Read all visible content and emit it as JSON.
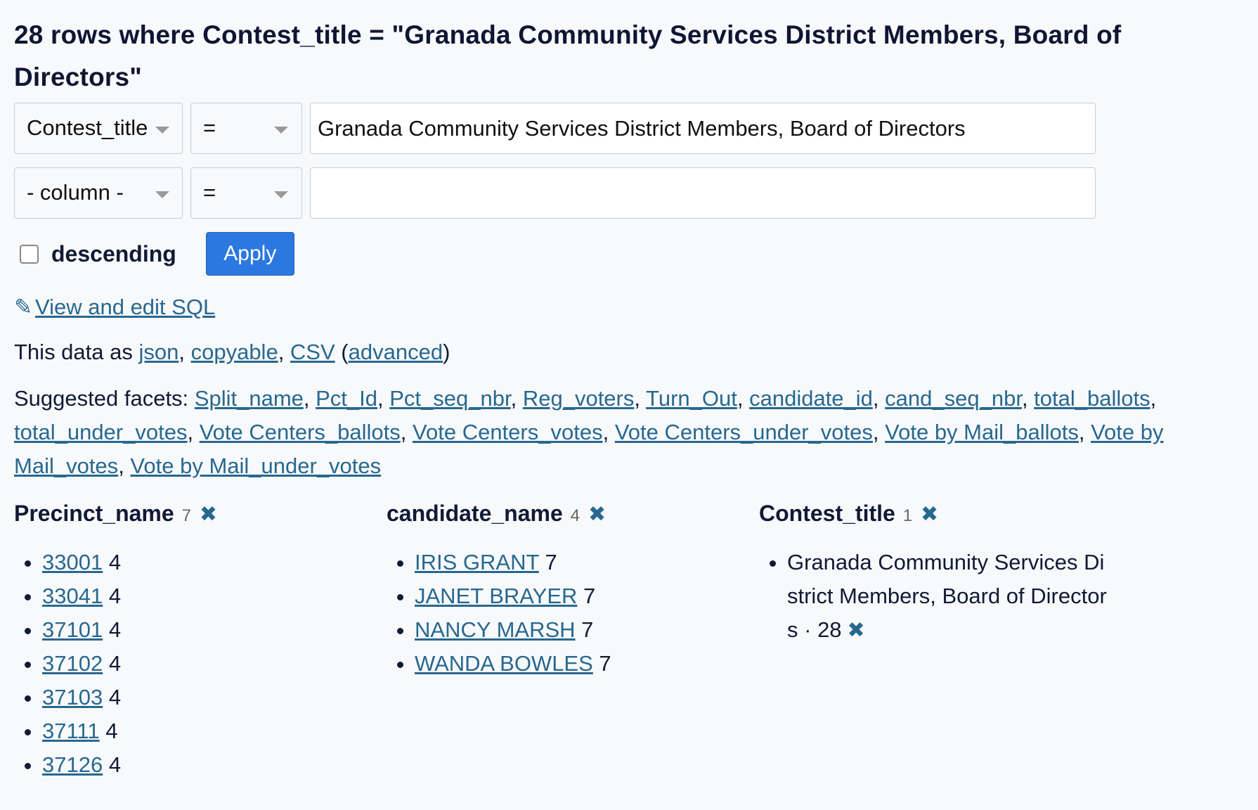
{
  "title": "28 rows where Contest_title = \"Granada Community Services District Members, Board of Directors\"",
  "filters": [
    {
      "column": "Contest_title",
      "op": "=",
      "value": "Granada Community Services District Members, Board of Directors"
    },
    {
      "column": "- column -",
      "op": "=",
      "value": ""
    }
  ],
  "descending_label": "descending",
  "apply_label": "Apply",
  "sql_link": "View and edit SQL",
  "pencil_glyph": "✎",
  "data_as": {
    "prefix": "This data as ",
    "json": "json",
    "copyable": "copyable",
    "csv": "CSV",
    "advanced": "advanced"
  },
  "suggested": {
    "label": "Suggested facets:",
    "items": [
      "Split_name",
      "Pct_Id",
      "Pct_seq_nbr",
      "Reg_voters",
      "Turn_Out",
      "candidate_id",
      "cand_seq_nbr",
      "total_ballots",
      "total_under_votes",
      "Vote Centers_ballots",
      "Vote Centers_votes",
      "Vote Centers_under_votes",
      "Vote by Mail_ballots",
      "Vote by Mail_votes",
      "Vote by Mail_under_votes"
    ]
  },
  "facets": [
    {
      "name": "Precinct_name",
      "count": "7",
      "items": [
        {
          "label": "33001",
          "count": "4"
        },
        {
          "label": "33041",
          "count": "4"
        },
        {
          "label": "37101",
          "count": "4"
        },
        {
          "label": "37102",
          "count": "4"
        },
        {
          "label": "37103",
          "count": "4"
        },
        {
          "label": "37111",
          "count": "4"
        },
        {
          "label": "37126",
          "count": "4"
        }
      ]
    },
    {
      "name": "candidate_name",
      "count": "4",
      "items": [
        {
          "label": "IRIS GRANT",
          "count": "7"
        },
        {
          "label": "JANET BRAYER",
          "count": "7"
        },
        {
          "label": "NANCY MARSH",
          "count": "7"
        },
        {
          "label": "WANDA BOWLES",
          "count": "7"
        }
      ]
    },
    {
      "name": "Contest_title",
      "count": "1",
      "selected": {
        "label": "Granada Community Services District Members, Board of Directors",
        "count": "28"
      }
    }
  ],
  "remove_glyph": "✖"
}
